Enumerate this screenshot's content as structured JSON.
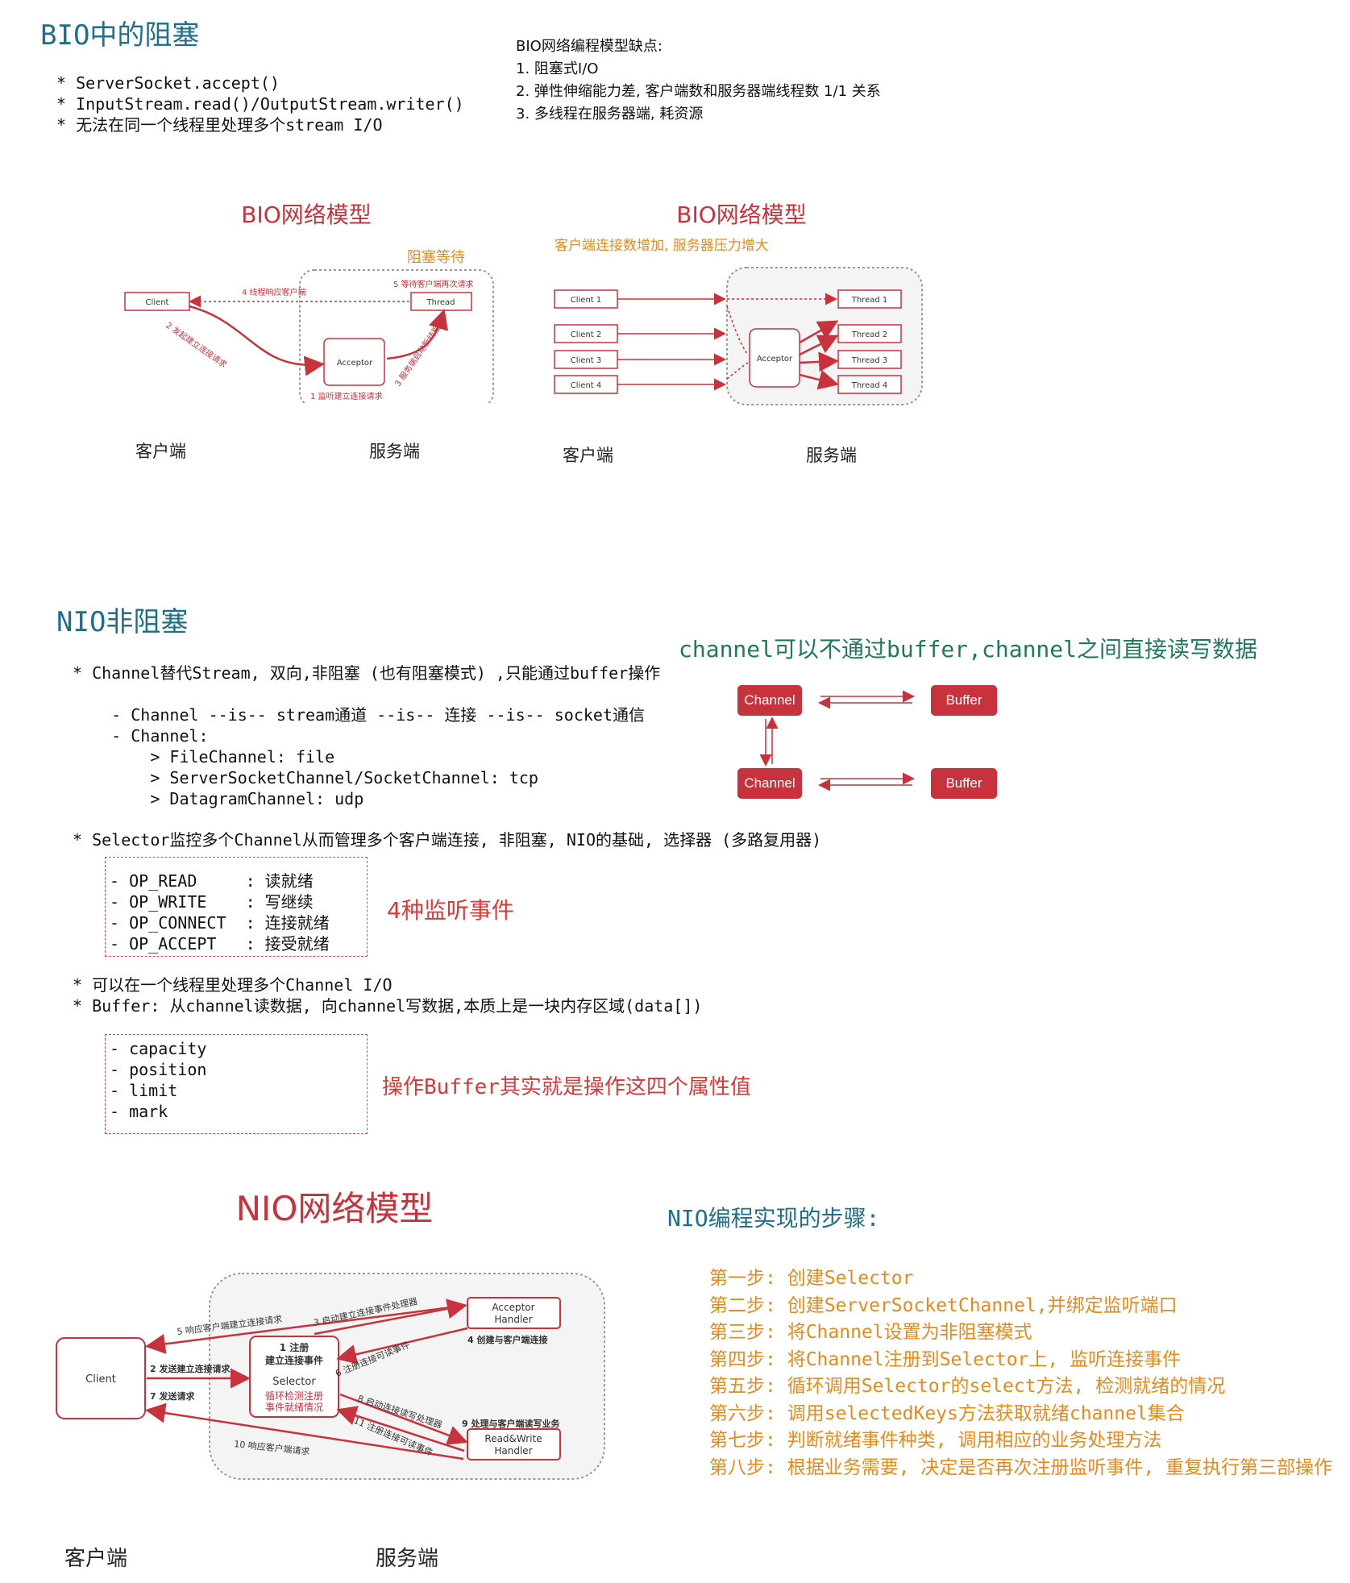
{
  "bio": {
    "title": "BIO中的阻塞",
    "bullets": [
      "* ServerSocket.accept()",
      "* InputStream.read()/OutputStream.writer()",
      "* 无法在同一个线程里处理多个stream I/O"
    ],
    "drawbacks_title": "BIO网络编程模型缺点:",
    "drawbacks": [
      "1. 阻塞式I/O",
      "2. 弹性伸缩能力差, 客户端数和服务器端线程数 1/1 关系",
      "3. 多线程在服务器端, 耗资源"
    ],
    "diagram1": {
      "title": "BIO网络模型",
      "blocking_label": "阻塞等待",
      "client": "Client",
      "thread": "Thread",
      "acceptor": "Acceptor",
      "step1": "1 监听建立连接请求",
      "step2": "2 发起建立连接请求",
      "step3": "3 服务端启动新线程",
      "step4": "4 线程响应客户端",
      "step5": "5 等待客户端再次请求",
      "client_side": "客户端",
      "server_side": "服务端"
    },
    "diagram2": {
      "title": "BIO网络模型",
      "subtitle": "客户端连接数增加, 服务器压力增大",
      "clients": [
        "Client 1",
        "Client 2",
        "Client 3",
        "Client 4"
      ],
      "threads": [
        "Thread 1",
        "Thread 2",
        "Thread 3",
        "Thread 4"
      ],
      "acceptor": "Acceptor",
      "client_side": "客户端",
      "server_side": "服务端"
    }
  },
  "nio": {
    "title": "NIO非阻塞",
    "lines": [
      "* Channel替代Stream, 双向,非阻塞 (也有阻塞模式) ,只能通过buffer操作",
      "",
      "    - Channel --is-- stream通道 --is-- 连接 --is-- socket通信",
      "    - Channel:",
      "        > FileChannel: file",
      "        > ServerSocketChannel/SocketChannel: tcp",
      "        > DatagramChannel: udp"
    ],
    "selector_line": "* Selector监控多个Channel从而管理多个客户端连接, 非阻塞, NIO的基础, 选择器 (多路复用器)",
    "events": [
      "- OP_READ     : 读就绪",
      "- OP_WRITE    : 写继续",
      "- OP_CONNECT  : 连接就绪",
      "- OP_ACCEPT   : 接受就绪"
    ],
    "events_note": "4种监听事件",
    "thread_line": "* 可以在一个线程里处理多个Channel I/O",
    "buffer_line": "* Buffer: 从channel读数据, 向channel写数据,本质上是一块内存区域(data[])",
    "buffer_props": [
      "- capacity",
      "- position",
      "- limit",
      "- mark"
    ],
    "buffer_note": "操作Buffer其实就是操作这四个属性值",
    "channel_note": "channel可以不通过buffer,channel之间直接读写数据",
    "channel_label": "Channel",
    "buffer_label": "Buffer"
  },
  "nio_model": {
    "title": "NIO网络模型",
    "client": "Client",
    "selector_top1": "1 注册",
    "selector_top2": "建立连接事件",
    "selector": "Selector",
    "selector_bottom1": "循环检测注册",
    "selector_bottom2": "事件就绪情况",
    "acceptor1": "Acceptor",
    "acceptor2": "Handler",
    "rw1": "Read&Write",
    "rw2": "Handler",
    "e2": "2 发送建立连接请求",
    "e3": "3 启动建立连接事件处理器",
    "e4": "4 创建与客户端连接",
    "e5": "5 响应客户端建立连接请求",
    "e6": "6 注册连接可读事件",
    "e7": "7 发送请求",
    "e8": "8 启动连接读写处理器",
    "e9": "9 处理与客户端读写业务",
    "e10": "10 响应客户端请求",
    "e11": "11 注册连接可读事件",
    "client_side": "客户端",
    "server_side": "服务端"
  },
  "steps": {
    "title": "NIO编程实现的步骤:",
    "items": [
      "第一步: 创建Selector",
      "第二步: 创建ServerSocketChannel,并绑定监听端口",
      "第三步: 将Channel设置为非阻塞模式",
      "第四步: 将Channel注册到Selector上, 监听连接事件",
      "第五步: 循环调用Selector的select方法, 检测就绪的情况",
      "第六步: 调用selectedKeys方法获取就绪channel集合",
      "第七步: 判断就绪事件种类, 调用相应的业务处理方法",
      "第八步: 根据业务需要, 决定是否再次注册监听事件, 重复执行第三部操作"
    ]
  },
  "colors": {
    "teal": "#1f6f8b",
    "green": "#1f7a5a",
    "red": "#c8323c",
    "orange": "#e88a1a"
  }
}
